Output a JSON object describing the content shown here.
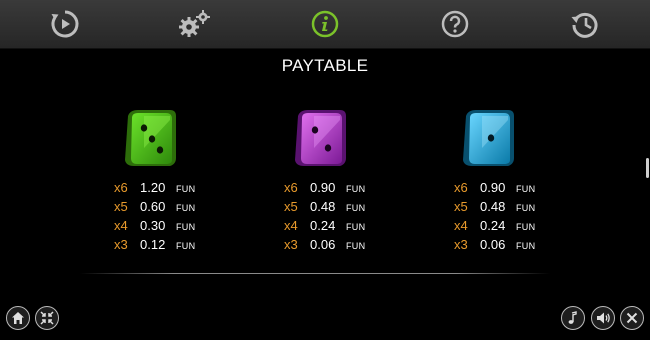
{
  "nav": {
    "items": [
      {
        "name": "autoplay-icon"
      },
      {
        "name": "settings-icon"
      },
      {
        "name": "info-icon",
        "active": true
      },
      {
        "name": "help-icon"
      },
      {
        "name": "history-icon"
      }
    ]
  },
  "paytable": {
    "title": "PAYTABLE",
    "currency": "FUN",
    "symbols": [
      {
        "die": "green-die-three",
        "color": "#5fd21e",
        "rows": [
          {
            "mult": "x6",
            "value": "1.20"
          },
          {
            "mult": "x5",
            "value": "0.60"
          },
          {
            "mult": "x4",
            "value": "0.30"
          },
          {
            "mult": "x3",
            "value": "0.12"
          }
        ]
      },
      {
        "die": "purple-die-two",
        "color": "#c236d8",
        "rows": [
          {
            "mult": "x6",
            "value": "0.90"
          },
          {
            "mult": "x5",
            "value": "0.48"
          },
          {
            "mult": "x4",
            "value": "0.24"
          },
          {
            "mult": "x3",
            "value": "0.06"
          }
        ]
      },
      {
        "die": "blue-die-one",
        "color": "#22b2e8",
        "rows": [
          {
            "mult": "x6",
            "value": "0.90"
          },
          {
            "mult": "x5",
            "value": "0.48"
          },
          {
            "mult": "x4",
            "value": "0.24"
          },
          {
            "mult": "x3",
            "value": "0.06"
          }
        ]
      }
    ]
  },
  "colors": {
    "accent": "#7bc22a",
    "multiplier": "#e89a2c",
    "background": "#000000"
  },
  "bottom_controls": {
    "left": [
      "home-icon",
      "fullscreen-icon"
    ],
    "right": [
      "music-icon",
      "sound-icon",
      "close-icon"
    ]
  }
}
